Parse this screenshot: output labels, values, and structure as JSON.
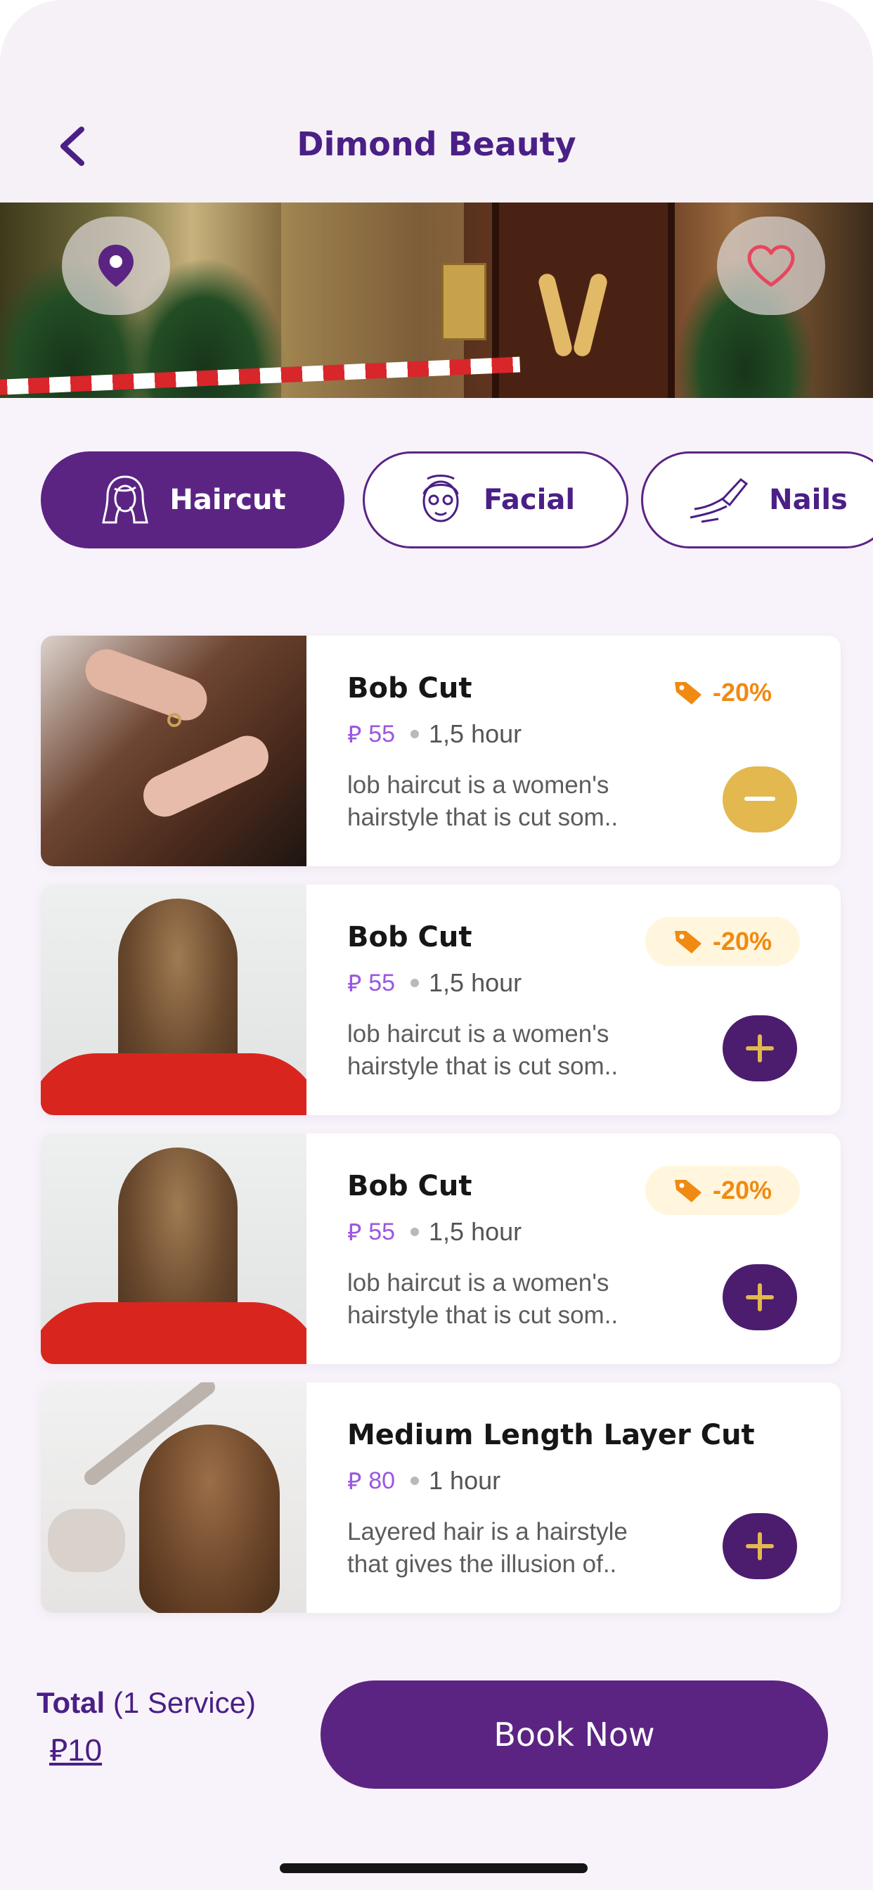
{
  "header": {
    "title": "Dimond Beauty",
    "back_icon": "chevron-left-icon"
  },
  "banner": {
    "location_icon": "map-pin-icon",
    "favorite_icon": "heart-icon"
  },
  "categories": [
    {
      "label": "Haircut",
      "icon": "hair-icon",
      "selected": true
    },
    {
      "label": "Facial",
      "icon": "face-mask-icon",
      "selected": false
    },
    {
      "label": "Nails",
      "icon": "nail-polish-icon",
      "selected": false
    }
  ],
  "services": [
    {
      "name": "Bob Cut",
      "currency": "⃁",
      "price": "55",
      "duration": "1,5 hour",
      "discount": "-20%",
      "desc_line1": "lob haircut is a women's",
      "desc_line2": "hairstyle that is cut som..",
      "action": "remove"
    },
    {
      "name": "Bob Cut",
      "currency": "⃁",
      "price": "55",
      "duration": "1,5 hour",
      "discount": "-20%",
      "desc_line1": "lob haircut is a women's",
      "desc_line2": "hairstyle that is cut som..",
      "action": "add"
    },
    {
      "name": "Bob Cut",
      "currency": "⃁",
      "price": "55",
      "duration": "1,5 hour",
      "discount": "-20%",
      "desc_line1": "lob haircut is a women's",
      "desc_line2": "hairstyle that is cut som..",
      "action": "add"
    },
    {
      "name": "Medium Length Layer Cut",
      "currency": "⃁",
      "price": "80",
      "duration": "1 hour",
      "desc_line1": "Layered hair is a hairstyle",
      "desc_line2": "that gives the illusion of..",
      "action": "add"
    }
  ],
  "footer": {
    "total_label": "Total",
    "total_count": "(1 Service)",
    "total_amount": "⃁10",
    "book_label": "Book Now"
  },
  "colors": {
    "brand_purple": "#5b2483",
    "title_purple": "#4a1f86",
    "price_purple": "#9b57e0",
    "discount_orange": "#f08a12",
    "minus_gold": "#e2b84f",
    "plus_dark": "#4c1c6e"
  }
}
